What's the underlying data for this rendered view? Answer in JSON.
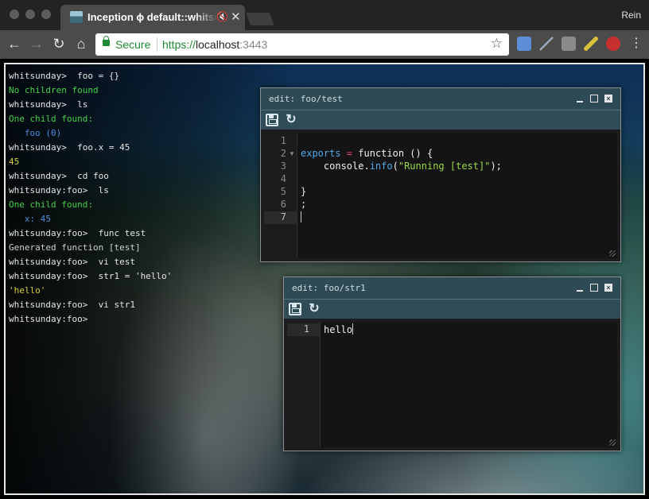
{
  "browser": {
    "tab_title": "Inception ϕ default::whitsunday",
    "mute_icon": "🔇",
    "close_icon": "✕",
    "profile_name": "Rein",
    "secure_label": "Secure",
    "url_scheme": "https://",
    "url_host": "localhost",
    "url_port": ":3443"
  },
  "terminal": {
    "lines": [
      {
        "cls": "c-prompt",
        "text": "whitsunday>  foo = {}"
      },
      {
        "cls": "c-green",
        "text": "No children found"
      },
      {
        "cls": "c-prompt",
        "text": "whitsunday>  ls"
      },
      {
        "cls": "c-green",
        "text": "One child found:"
      },
      {
        "cls": "c-blue",
        "text": "   foo (0)"
      },
      {
        "cls": "c-prompt",
        "text": "whitsunday>  foo.x = 45"
      },
      {
        "cls": "c-yellow",
        "text": "45"
      },
      {
        "cls": "c-prompt",
        "text": "whitsunday>  cd foo"
      },
      {
        "cls": "c-prompt",
        "text": "whitsunday:foo>  ls"
      },
      {
        "cls": "c-green",
        "text": "One child found:"
      },
      {
        "cls": "c-blue",
        "text": "   x: 45"
      },
      {
        "cls": "c-prompt",
        "text": "whitsunday:foo>  func test"
      },
      {
        "cls": "c-gray",
        "text": "Generated function [test]"
      },
      {
        "cls": "c-prompt",
        "text": "whitsunday:foo>  vi test"
      },
      {
        "cls": "c-prompt",
        "text": "whitsunday:foo>  str1 = 'hello'"
      },
      {
        "cls": "c-yellow",
        "text": "'hello'"
      },
      {
        "cls": "c-prompt",
        "text": "whitsunday:foo>  vi str1"
      },
      {
        "cls": "c-prompt",
        "text": "whitsunday:foo>"
      }
    ]
  },
  "editor_test": {
    "title": "edit: foo/test",
    "line_numbers": [
      "1",
      "2",
      "3",
      "4",
      "5",
      "6",
      "7"
    ],
    "code": {
      "l2_kw": "exports",
      "l2_eq": " = ",
      "l2_fn": "function () {",
      "l3_obj": "    console.",
      "l3_method": "info",
      "l3_open": "(",
      "l3_str": "\"Running [test]\"",
      "l3_close": ");",
      "l5": "}",
      "l6": ";"
    }
  },
  "editor_str1": {
    "title": "edit: foo/str1",
    "line_numbers": [
      "1"
    ],
    "code": {
      "l1": "hello"
    }
  }
}
